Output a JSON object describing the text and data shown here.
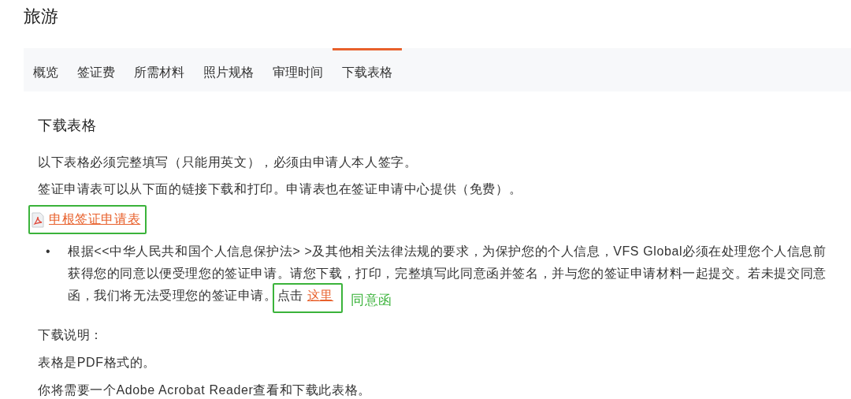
{
  "page_title": "旅游",
  "tabs": [
    {
      "label": "概览",
      "selected": false
    },
    {
      "label": "签证费",
      "selected": false
    },
    {
      "label": "所需材料",
      "selected": false
    },
    {
      "label": "照片规格",
      "selected": false
    },
    {
      "label": "审理时间",
      "selected": false
    },
    {
      "label": "下载表格",
      "selected": true
    }
  ],
  "section": {
    "heading": "下载表格",
    "paragraphs": [
      "以下表格必须完整填写（只能用英文），必须由申请人本人签字。",
      "签证申请表可以从下面的链接下载和打印。申请表也在签证申请中心提供（免费）。"
    ],
    "download_link": {
      "label": "申根签证申请表",
      "highlighted": true
    },
    "bullets": [
      {
        "marker": "•",
        "text": "根据<<中华人民共和国个人信息保护法> >及其他相关法律法规的要求，为保护您的个人信息，VFS Global必须在处理您个人信息前获得您的同意以便受理您的签证申请。请您下载，打印，完整填写此同意函并签名，并与您的签证申请材料一起提交。若未提交同意函，我们将无法受理您的签证申请。",
        "action_text": "点击",
        "link": "这里",
        "highlighted": true,
        "annotation": "同意函"
      }
    ],
    "notes": [
      "下载说明：",
      "表格是PDF格式的。",
      "你将需要一个Adobe Acrobat Reader查看和下载此表格。"
    ]
  }
}
